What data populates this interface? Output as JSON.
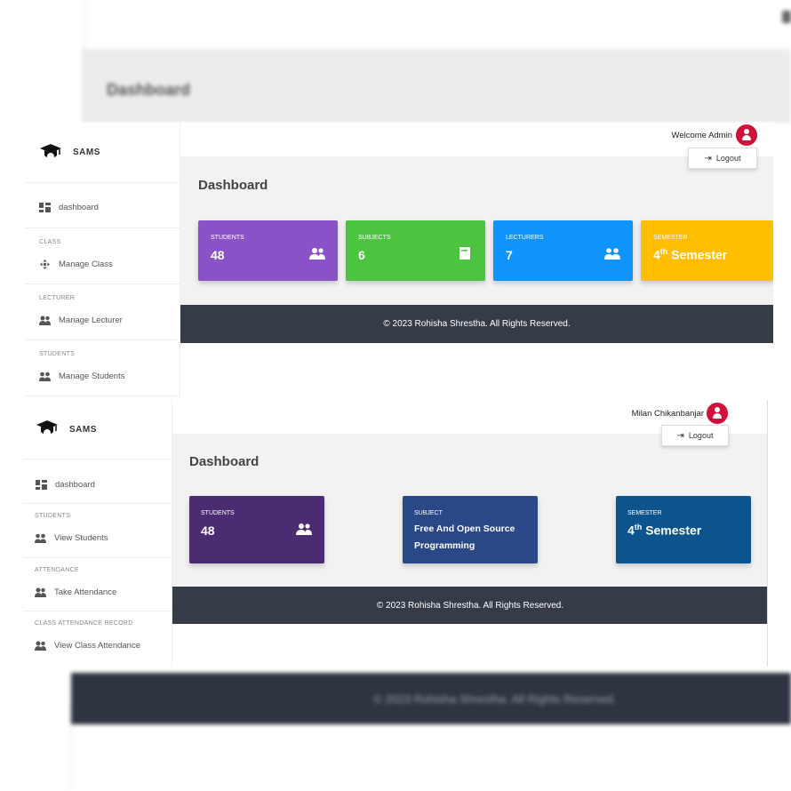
{
  "background": {
    "title": "Dashboard",
    "footer": "© 2023 Rohisha Shrestha. All Rights Reserved."
  },
  "admin": {
    "brand": "SAMS",
    "welcome": "Welcome Admin",
    "logout": "Logout",
    "title": "Dashboard",
    "sidebar": {
      "dashboard": "dashboard",
      "sections": [
        {
          "title": "CLASS",
          "item": "Manage Class",
          "icon": "move-icon"
        },
        {
          "title": "LECTURER",
          "item": "Manage Lecturer",
          "icon": "users-icon"
        },
        {
          "title": "STUDENTS",
          "item": "Manage Students",
          "icon": "user-group-icon"
        }
      ]
    },
    "cards": [
      {
        "label": "STUDENTS",
        "value": "48",
        "color": "#8b52c8",
        "icon": "users-icon"
      },
      {
        "label": "SUBJECTS",
        "value": "6",
        "color": "#4cc43f",
        "icon": "book-icon"
      },
      {
        "label": "LECTURERS",
        "value": "7",
        "color": "#0f94fd",
        "icon": "users-icon"
      },
      {
        "label": "SEMESTER",
        "value": "4",
        "value_sup": "th",
        "value_suffix": "Semester",
        "color": "#ffbf00"
      }
    ],
    "footer": "© 2023 Rohisha Shrestha. All Rights Reserved."
  },
  "lecturer": {
    "brand": "SAMS",
    "welcome": "Milan Chikanbanjar",
    "logout": "Logout",
    "title": "Dashboard",
    "sidebar": {
      "dashboard": "dashboard",
      "sections": [
        {
          "title": "STUDENTS",
          "item": "View Students",
          "icon": "user-group-icon"
        },
        {
          "title": "ATTENDANCE",
          "item": "Take Attendance",
          "icon": "users-icon"
        },
        {
          "title": "CLASS ATTENDANCE RECORD",
          "item": "View Class Attendance",
          "icon": "users-icon"
        }
      ]
    },
    "cards": [
      {
        "label": "STUDENTS",
        "value": "48",
        "color": "#4b2c73",
        "icon": "users-icon"
      },
      {
        "label": "SUBJECT",
        "value_line1": "Free And Open Source",
        "value_line2": "Programming",
        "color": "#2a4787"
      },
      {
        "label": "SEMESTER",
        "value": "4",
        "value_sup": "th",
        "value_suffix": "Semester",
        "color": "#0b548e"
      }
    ],
    "footer": "© 2023 Rohisha Shrestha. All Rights Reserved."
  }
}
